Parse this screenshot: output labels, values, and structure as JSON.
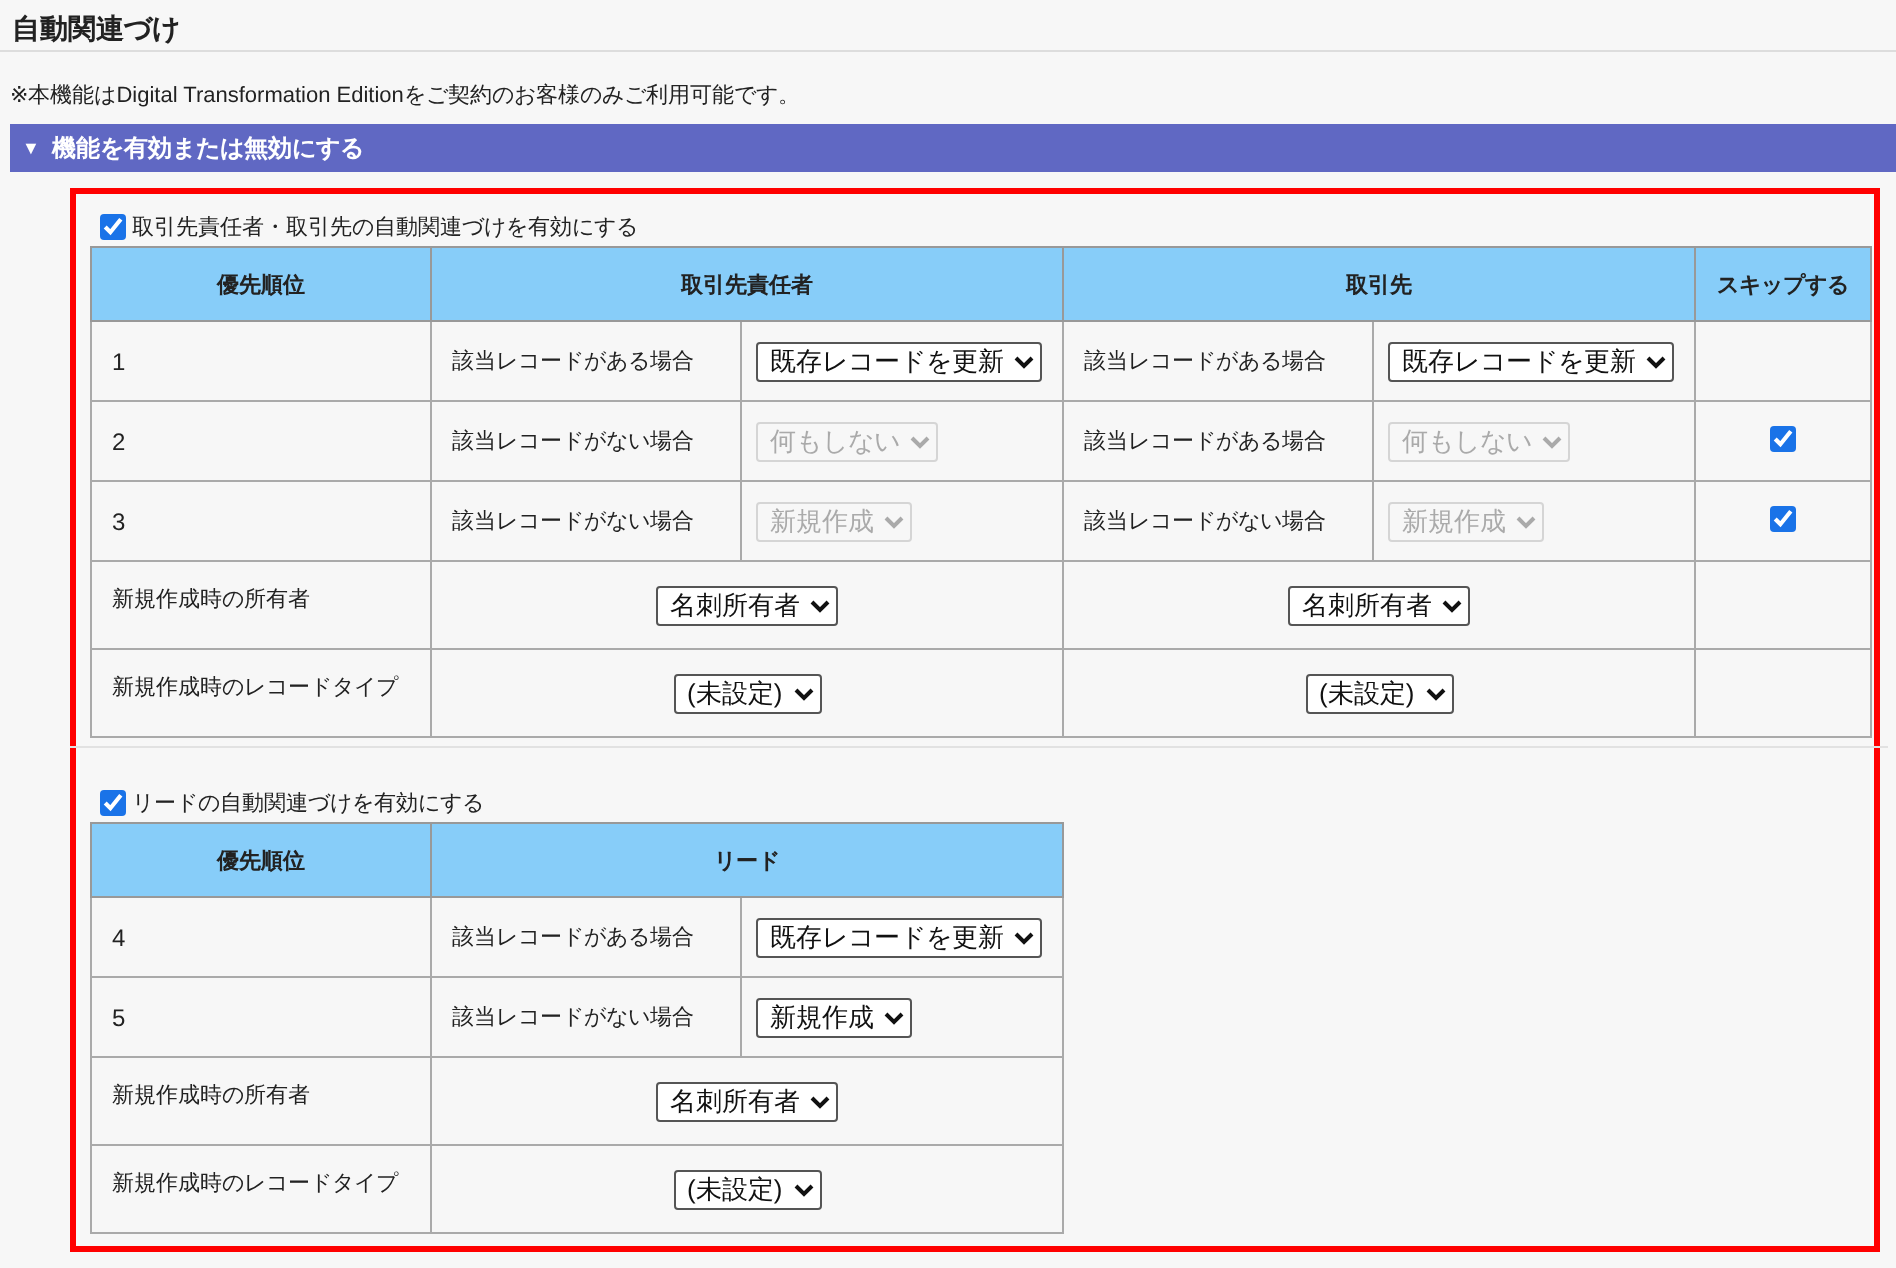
{
  "page_title": "自動関連づけ",
  "notice": "※本機能はDigital Transformation Editionをご契約のお客様のみご利用可能です。",
  "section_bar": {
    "icon": "▼",
    "label": "機能を有効または無効にする",
    "expanded": true
  },
  "groups": [
    {
      "checkbox": {
        "label": "取引先責任者・取引先の自動関連づけを有効にする",
        "checked": true
      },
      "columns": [
        {
          "label": "優先順位",
          "kind": "priority"
        },
        {
          "label": "取引先責任者",
          "kind": "object",
          "colspan": 2
        },
        {
          "label": "取引先",
          "kind": "object",
          "colspan": 2
        },
        {
          "label": "スキップする",
          "kind": "skip"
        }
      ],
      "rows": [
        {
          "kind": "priority",
          "cells": [
            {
              "kind": "number",
              "text": "1"
            },
            {
              "kind": "condition",
              "text": "該当レコードがある場合"
            },
            {
              "kind": "dropdown",
              "value": "既存レコードを更新",
              "disabled": false
            },
            {
              "kind": "condition",
              "text": "該当レコードがある場合"
            },
            {
              "kind": "dropdown",
              "value": "既存レコードを更新",
              "disabled": false
            },
            ""
          ]
        },
        {
          "kind": "priority",
          "cells": [
            {
              "kind": "number",
              "text": "2"
            },
            {
              "kind": "condition",
              "text": "該当レコードがない場合"
            },
            {
              "kind": "dropdown",
              "value": "何もしない",
              "disabled": true
            },
            {
              "kind": "condition",
              "text": "該当レコードがある場合"
            },
            {
              "kind": "dropdown",
              "value": "何もしない",
              "disabled": true
            },
            {
              "kind": "checkbox",
              "checked": true
            }
          ]
        },
        {
          "kind": "priority",
          "cells": [
            {
              "kind": "number",
              "text": "3"
            },
            {
              "kind": "condition",
              "text": "該当レコードがない場合"
            },
            {
              "kind": "dropdown",
              "value": "新規作成",
              "disabled": true
            },
            {
              "kind": "condition",
              "text": "該当レコードがない場合"
            },
            {
              "kind": "dropdown",
              "value": "新規作成",
              "disabled": true
            },
            {
              "kind": "checkbox",
              "checked": true
            }
          ]
        },
        {
          "kind": "setting",
          "cells": [
            {
              "kind": "label",
              "text": "新規作成時の所有者"
            },
            {
              "kind": "dropdown",
              "value": "名刺所有者",
              "colspan": 2
            },
            {
              "kind": "dropdown",
              "value": "名刺所有者",
              "colspan": 2
            },
            ""
          ]
        },
        {
          "kind": "setting",
          "cells": [
            {
              "kind": "label",
              "text": "新規作成時のレコードタイプ"
            },
            {
              "kind": "dropdown",
              "value": "(未設定)",
              "colspan": 2
            },
            {
              "kind": "dropdown",
              "value": "(未設定)",
              "colspan": 2
            },
            ""
          ]
        }
      ]
    },
    {
      "checkbox": {
        "label": "リードの自動関連づけを有効にする",
        "checked": true
      },
      "columns": [
        {
          "label": "優先順位",
          "kind": "priority"
        },
        {
          "label": "リード",
          "kind": "object",
          "colspan": 2
        }
      ],
      "rows": [
        {
          "kind": "priority",
          "cells": [
            {
              "kind": "number",
              "text": "4"
            },
            {
              "kind": "condition",
              "text": "該当レコードがある場合"
            },
            {
              "kind": "dropdown",
              "value": "既存レコードを更新",
              "disabled": false
            }
          ]
        },
        {
          "kind": "priority",
          "cells": [
            {
              "kind": "number",
              "text": "5"
            },
            {
              "kind": "condition",
              "text": "該当レコードがない場合"
            },
            {
              "kind": "dropdown",
              "value": "新規作成",
              "disabled": false
            }
          ]
        },
        {
          "kind": "setting",
          "cells": [
            {
              "kind": "label",
              "text": "新規作成時の所有者"
            },
            {
              "kind": "dropdown",
              "value": "名刺所有者",
              "colspan": 2
            }
          ]
        },
        {
          "kind": "setting",
          "cells": [
            {
              "kind": "label",
              "text": "新規作成時のレコードタイプ"
            },
            {
              "kind": "dropdown",
              "value": "(未設定)",
              "colspan": 2
            }
          ]
        }
      ]
    }
  ]
}
